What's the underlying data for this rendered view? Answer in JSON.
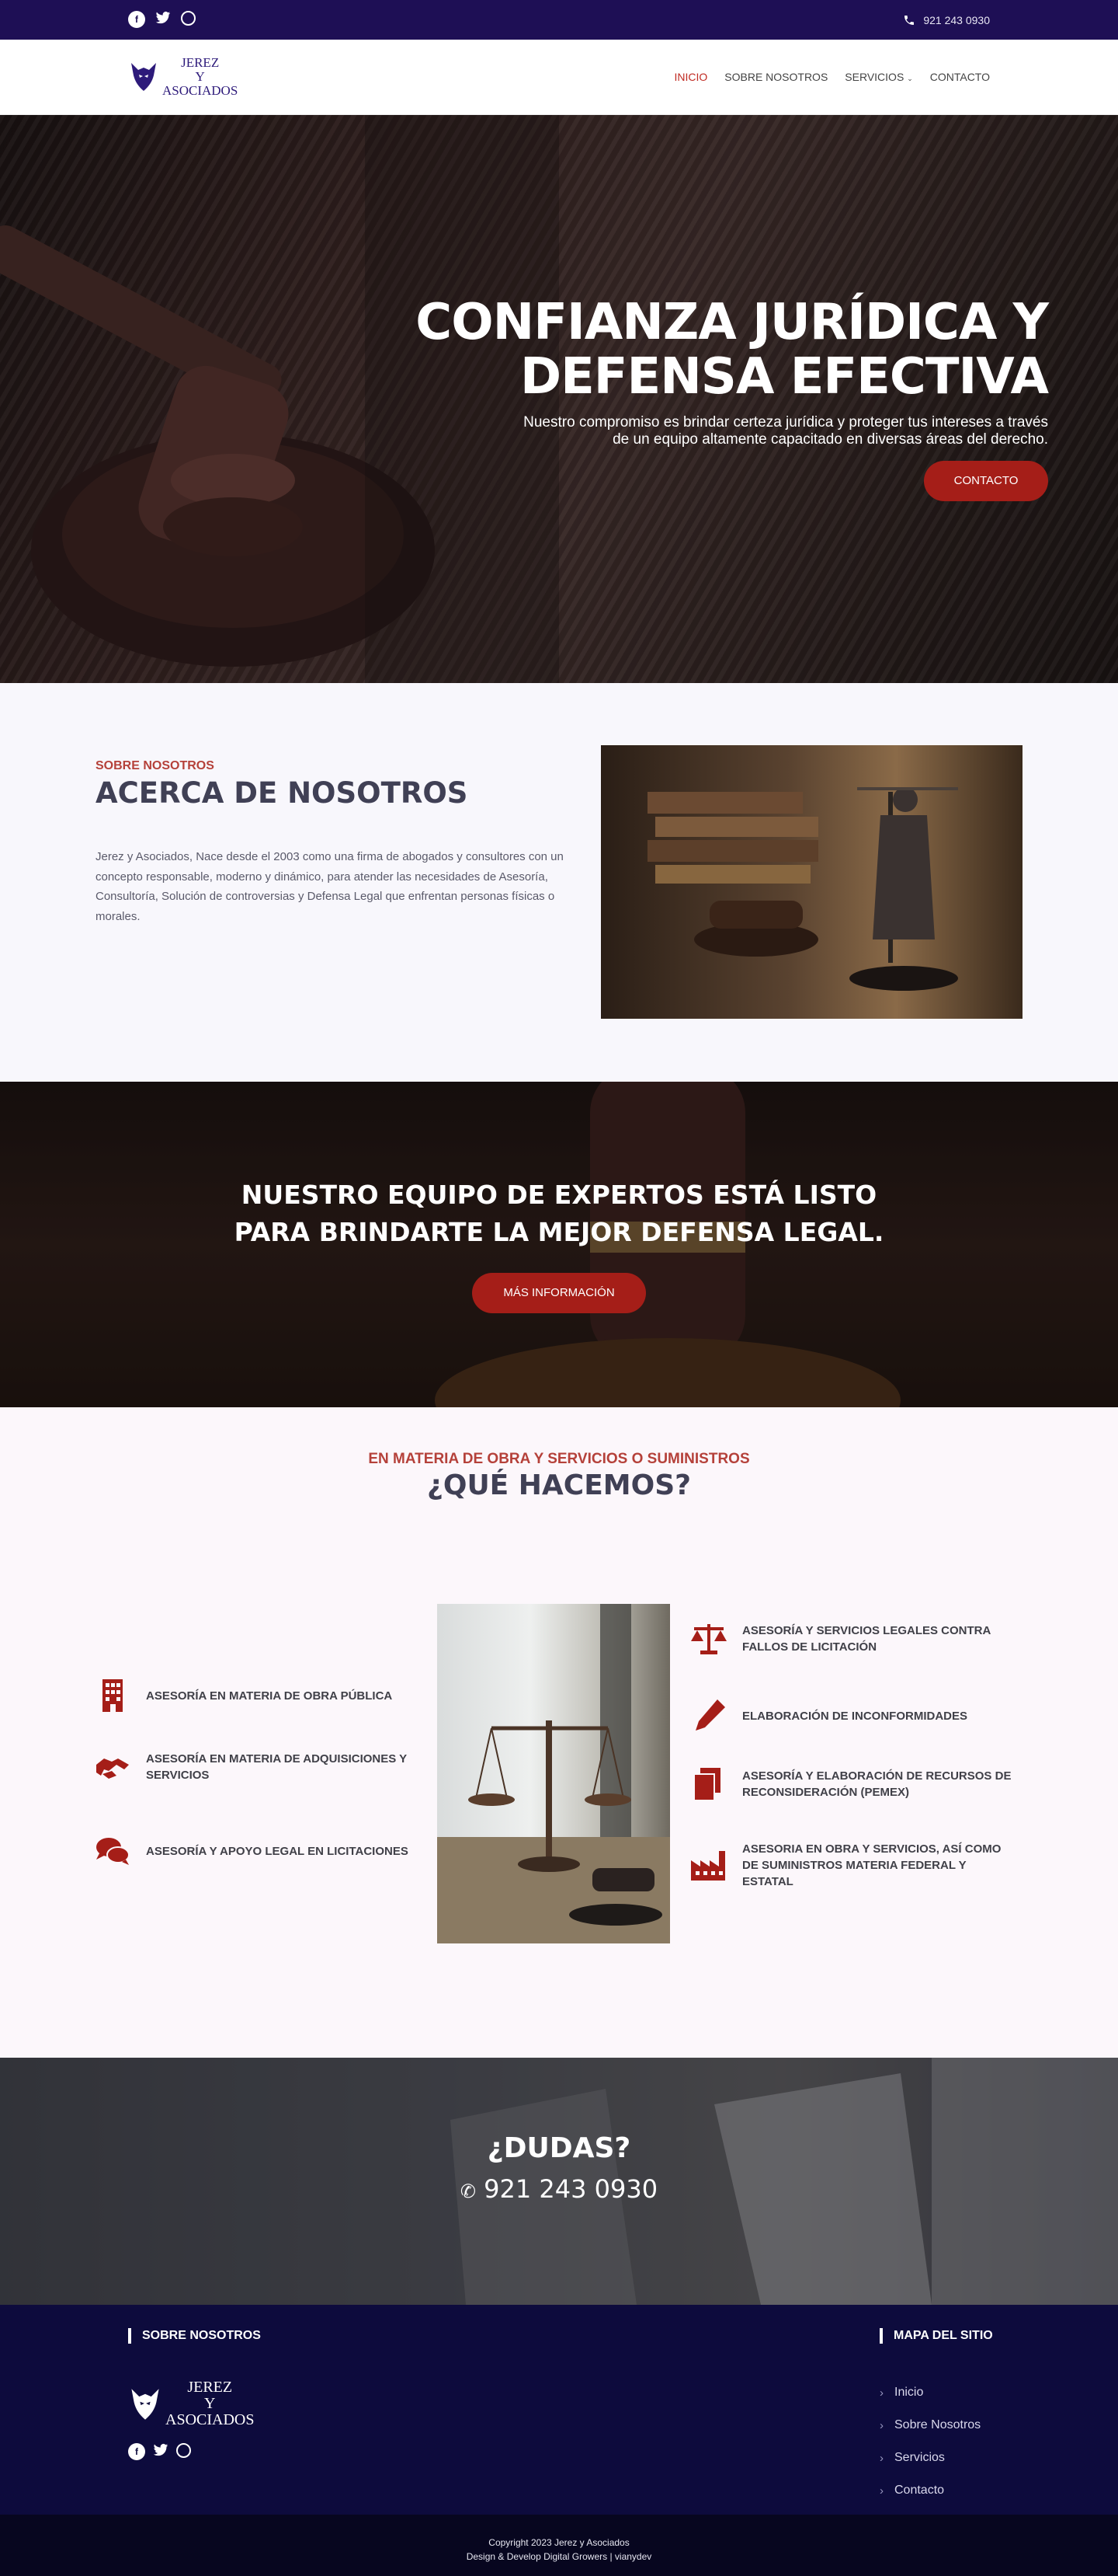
{
  "topbar": {
    "social": [
      "facebook-icon",
      "twitter-icon",
      "whatsapp-icon"
    ],
    "phone": "921 243 0930"
  },
  "brand": {
    "logo_line1": "JEREZ",
    "logo_line2": "Y",
    "logo_line3": "ASOCIADOS"
  },
  "nav": {
    "items": [
      {
        "label": "INICIO",
        "active": true
      },
      {
        "label": "SOBRE NOSOTROS",
        "active": false
      },
      {
        "label": "SERVICIOS",
        "active": false
      },
      {
        "label": "CONTACTO",
        "active": false
      }
    ]
  },
  "hero": {
    "title_line1": "CONFIANZA JURÍDICA Y",
    "title_line2": "DEFENSA EFECTIVA",
    "subtitle_line1": "Nuestro compromiso es brindar certeza jurídica y proteger tus intereses a través",
    "subtitle_line2": "de un equipo altamente capacitado en diversas áreas del derecho.",
    "button": "CONTACTO"
  },
  "about": {
    "eyebrow": "SOBRE NOSOTROS",
    "title": "ACERCA DE NOSOTROS",
    "body": "Jerez y Asociados, Nace desde el 2003 como una firma de abogados y consultores con un concepto responsable, moderno y dinámico, para atender las necesidades de Asesoría, Consultoría, Solución de controversias y Defensa Legal que enfrentan personas físicas o morales."
  },
  "cta": {
    "line1": "NUESTRO EQUIPO DE EXPERTOS ESTÁ LISTO",
    "line2": "PARA BRINDARTE LA MEJOR DEFENSA LEGAL.",
    "button": "MÁS INFORMACIÓN"
  },
  "services": {
    "eyebrow": "EN MATERIA DE OBRA Y SERVICIOS O SUMINISTROS",
    "title": "¿QUÉ HACEMOS?",
    "left": [
      {
        "label": "ASESORÍA EN MATERIA DE OBRA PÚBLICA",
        "icon": "building-icon"
      },
      {
        "label": "ASESORÍA EN MATERIA DE ADQUISICIONES Y SERVICIOS",
        "icon": "handshake-icon"
      },
      {
        "label": "ASESORÍA Y APOYO LEGAL EN LICITACIONES",
        "icon": "comments-icon"
      }
    ],
    "right": [
      {
        "label": "ASESORÍA Y SERVICIOS LEGALES CONTRA FALLOS DE LICITACIÓN",
        "icon": "scale-icon"
      },
      {
        "label": "ELABORACIÓN DE INCONFORMIDADES",
        "icon": "pencil-icon"
      },
      {
        "label": "ASESORÍA Y ELABORACIÓN DE RECURSOS DE RECONSIDERACIÓN (PEMEX)",
        "icon": "copy-icon"
      },
      {
        "label": "ASESORIA EN OBRA Y SERVICIOS, ASÍ COMO DE SUMINISTROS MATERIA FEDERAL Y ESTATAL",
        "icon": "industry-icon"
      }
    ]
  },
  "dudas": {
    "title": "¿DUDAS?",
    "phone": "921 243 0930"
  },
  "footer": {
    "about_heading": "SOBRE NOSOTROS",
    "sitemap_heading": "MAPA DEL SITIO",
    "links": [
      "Inicio",
      "Sobre Nosotros",
      "Servicios",
      "Contacto"
    ],
    "copyright": "Copyright 2023  Jerez y Asociados",
    "credits": "Design & Develop Digital Growers | vianydev"
  },
  "colors": {
    "navy": "#1e0f55",
    "accent": "#a51e18",
    "footer": "#0d0b3d"
  }
}
